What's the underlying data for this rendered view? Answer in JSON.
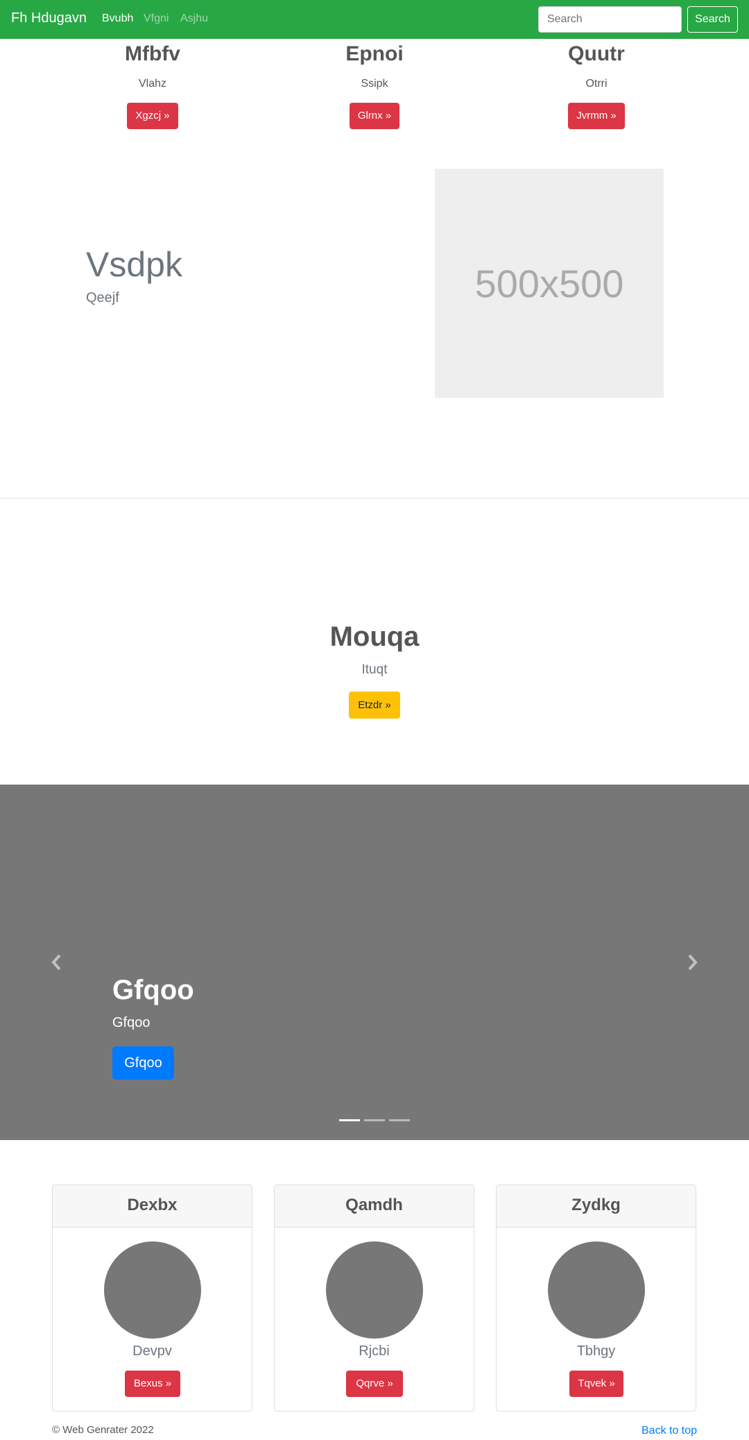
{
  "navbar": {
    "brand": "Fh Hdugavn",
    "links": [
      "Bvubh",
      "Vfgni",
      "Asjhu"
    ],
    "search_placeholder": "Search",
    "search_button": "Search",
    "bg_color": "#28a745"
  },
  "features": [
    {
      "title": "Mfbfv",
      "text": "Vlahz",
      "button": "Xgzcj »"
    },
    {
      "title": "Epnoi",
      "text": "Ssipk",
      "button": "Glrnx »"
    },
    {
      "title": "Quutr",
      "text": "Otrri",
      "button": "Jvrmm »"
    }
  ],
  "hero": {
    "title": "Vsdpk",
    "subtitle": "Qeejf",
    "image_label": "500x500"
  },
  "cta": {
    "title": "Mouqa",
    "subtitle": "Ituqt",
    "button": "Etzdr »"
  },
  "carousel": {
    "title": "Gfqoo",
    "subtitle": "Gfqoo",
    "button": "Gfqoo",
    "active_slide": 1,
    "slide_count": 3
  },
  "cards": [
    {
      "header": "Dexbx",
      "name": "Devpv",
      "button": "Bexus »"
    },
    {
      "header": "Qamdh",
      "name": "Rjcbi",
      "button": "Qqrve »"
    },
    {
      "header": "Zydkg",
      "name": "Tbhgy",
      "button": "Tqvek »"
    }
  ],
  "footer": {
    "copyright": "© Web Genrater 2022",
    "back_to_top": "Back to top"
  }
}
